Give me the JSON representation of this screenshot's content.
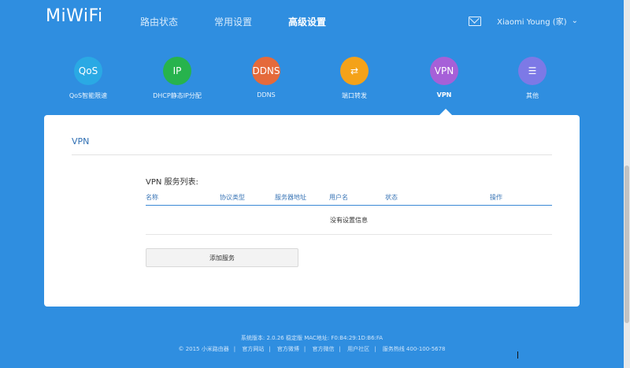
{
  "header": {
    "logo": "MiWiFi",
    "nav": [
      "路由状态",
      "常用设置",
      "高级设置"
    ],
    "active_nav": "高级设置",
    "user": "Xiaomi Young (家)",
    "chev": "⌄"
  },
  "features": [
    {
      "icon_text": "QoS",
      "label": "QoS智能限速",
      "color": "#2aa9e4",
      "icon": "qos-icon"
    },
    {
      "icon_text": "IP",
      "label": "DHCP静态IP分配",
      "color": "#27b34d",
      "icon": "ip-icon"
    },
    {
      "icon_text": "DDNS",
      "label": "DDNS",
      "color": "#e56a3b",
      "icon": "ddns-icon"
    },
    {
      "icon_text": "⇄",
      "label": "端口转发",
      "color": "#f4a219",
      "icon": "port-forward-icon"
    },
    {
      "icon_text": "VPN",
      "label": "VPN",
      "color": "#a660d8",
      "icon": "vpn-icon"
    },
    {
      "icon_text": "☰",
      "label": "其他",
      "color": "#7d79e6",
      "icon": "menu-icon"
    }
  ],
  "panel": {
    "title": "VPN",
    "list_title": "VPN 服务列表:",
    "columns": [
      "名称",
      "协议类型",
      "服务器地址",
      "用户名",
      "状态",
      "操作"
    ],
    "empty_text": "没有设置信息",
    "add_button": "添加服务"
  },
  "footer": {
    "line1": "系统版本: 2.0.26 稳定版   MAC地址: F0:B4:29:1D:B6:FA",
    "links": [
      "© 2015 小米路由器",
      "官方网站",
      "官方微博",
      "官方微信",
      "用户社区",
      "服务热线 400-100-5678"
    ]
  }
}
